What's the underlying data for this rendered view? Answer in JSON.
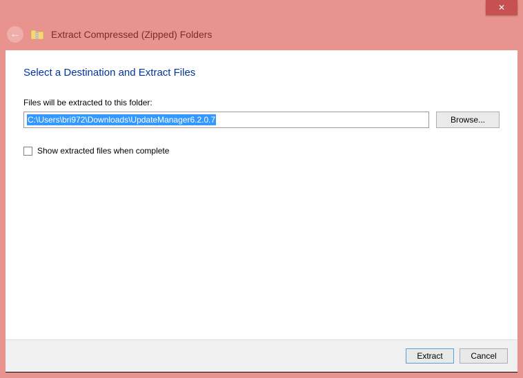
{
  "titlebar": {
    "close_glyph": "✕"
  },
  "header": {
    "back_glyph": "←",
    "title": "Extract Compressed (Zipped) Folders"
  },
  "content": {
    "heading": "Select a Destination and Extract Files",
    "folder_label": "Files will be extracted to this folder:",
    "path_value": "C:\\Users\\bri972\\Downloads\\UpdateManager6.2.0.7",
    "browse_label": "Browse...",
    "show_files_label": "Show extracted files when complete",
    "show_files_checked": false
  },
  "footer": {
    "extract_label": "Extract",
    "cancel_label": "Cancel"
  }
}
